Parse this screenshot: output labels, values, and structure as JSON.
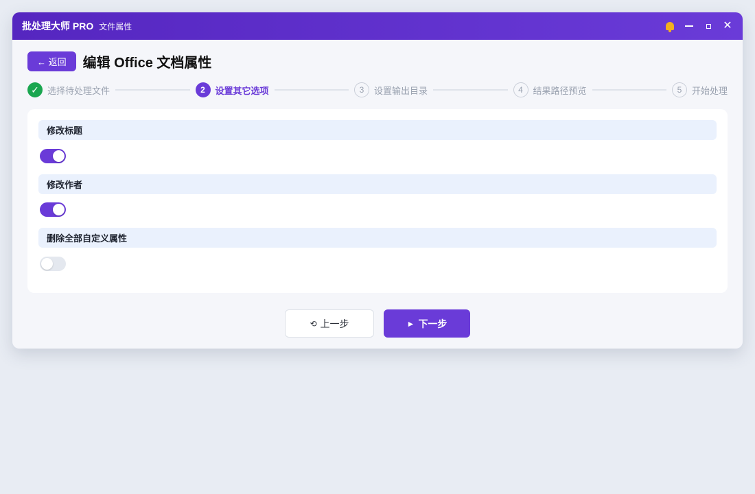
{
  "titlebar": {
    "app_name": "批处理大师 PRO",
    "subtitle": "文件属性",
    "icons": [
      "bell-icon",
      "minimize-icon",
      "maximize-icon",
      "close-icon"
    ]
  },
  "header": {
    "back_label": "← 返回",
    "title": "编辑 Office 文档属性"
  },
  "steps": [
    {
      "number": "✓",
      "label": "选择待处理文件",
      "state": "done"
    },
    {
      "number": "2",
      "label": "设置其它选项",
      "state": "active"
    },
    {
      "number": "3",
      "label": "设置输出目录",
      "state": "todo"
    },
    {
      "number": "4",
      "label": "结果路径预览",
      "state": "todo"
    },
    {
      "number": "5",
      "label": "开始处理",
      "state": "todo"
    }
  ],
  "options": [
    {
      "label": "修改标题",
      "enabled": true
    },
    {
      "label": "修改作者",
      "enabled": true
    },
    {
      "label": "删除全部自定义属性",
      "enabled": false
    }
  ],
  "footer": {
    "prev_icon": "⟲",
    "prev_label": "上一步",
    "next_icon": "►",
    "next_label": "下一步"
  },
  "colors": {
    "accent": "#6a3bd8",
    "done": "#1aa650",
    "option_header_bg": "#eaf1fd"
  }
}
